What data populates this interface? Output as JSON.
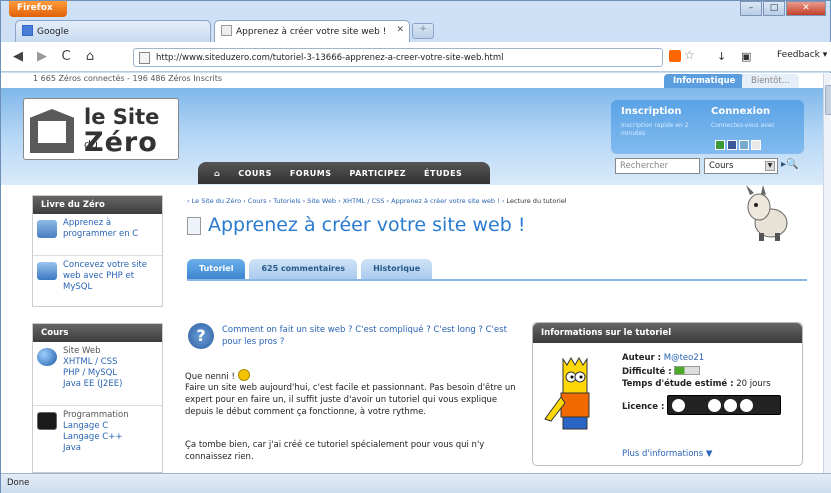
{
  "browser": {
    "menu_button": "Firefox",
    "tabs": [
      {
        "label": "Google",
        "active": false
      },
      {
        "label": "Apprenez à créer votre site web !",
        "active": true
      }
    ],
    "url": "http://www.siteduzero.com/tutoriel-3-13666-apprenez-a-creer-votre-site-web.html",
    "feedback_label": "Feedback",
    "status": "Done"
  },
  "site": {
    "online_stats": "1 665 Zéros connectés - 196 486 Zéros Inscrits",
    "category_tabs": [
      "Informatique",
      "Bientôt..."
    ],
    "logo": {
      "line1": "le Site",
      "du": "du",
      "line2": "Zéro"
    },
    "menu": [
      "Cours",
      "Forums",
      "Participez",
      "Études"
    ],
    "login": {
      "inscription": "Inscription",
      "inscription_sub": "Inscription rapide en 2 minutes",
      "connexion": "Connexion",
      "connexion_sub": "Connectez-vous avec"
    },
    "search": {
      "placeholder": "Rechercher",
      "select_value": "Cours"
    }
  },
  "sidebar": {
    "livre": {
      "title": "Livre du Zéro",
      "items": [
        "Apprenez à programmer en C",
        "Concevez votre site web avec PHP et MySQL"
      ]
    },
    "cours": {
      "title": "Cours",
      "groups": [
        {
          "heading": "Site Web",
          "items": [
            "XHTML / CSS",
            "PHP / MySQL",
            "Java EE (J2EE)"
          ]
        },
        {
          "heading": "Programmation",
          "items": [
            "Langage C",
            "Langage C++",
            "Java"
          ]
        }
      ]
    }
  },
  "main": {
    "breadcrumb": [
      "Le Site du Zéro",
      "Cours",
      "Tutoriels",
      "Site Web",
      "XHTML / CSS",
      "Apprenez à créer votre site web !"
    ],
    "breadcrumb_last": "Lecture du tutoriel",
    "title": "Apprenez à créer votre site web !",
    "tabs": [
      "Tutoriel",
      "625 commentaires",
      "Historique"
    ],
    "question": "Comment on fait un site web ? C'est compliqué ? C'est long ? C'est pour les pros ?",
    "paragraphs": [
      "Que nenni !",
      "Faire un site web aujourd'hui, c'est facile et passionnant. Pas besoin d'être un expert pour en faire un, il suffit juste d'avoir un tutoriel qui vous explique depuis le début comment ça fonctionne, à votre rythme.",
      "Ça tombe bien, car j'ai créé ce tutoriel spécialement pour vous qui n'y connaissez rien."
    ]
  },
  "info": {
    "title": "Informations sur le tutoriel",
    "author_label": "Auteur :",
    "author": "M@teo21",
    "difficulty_label": "Difficulté :",
    "difficulty_level": 0.4,
    "time_label": "Temps d'étude estimé :",
    "time": "20 jours",
    "license_label": "Licence :",
    "more": "Plus d'informations"
  }
}
